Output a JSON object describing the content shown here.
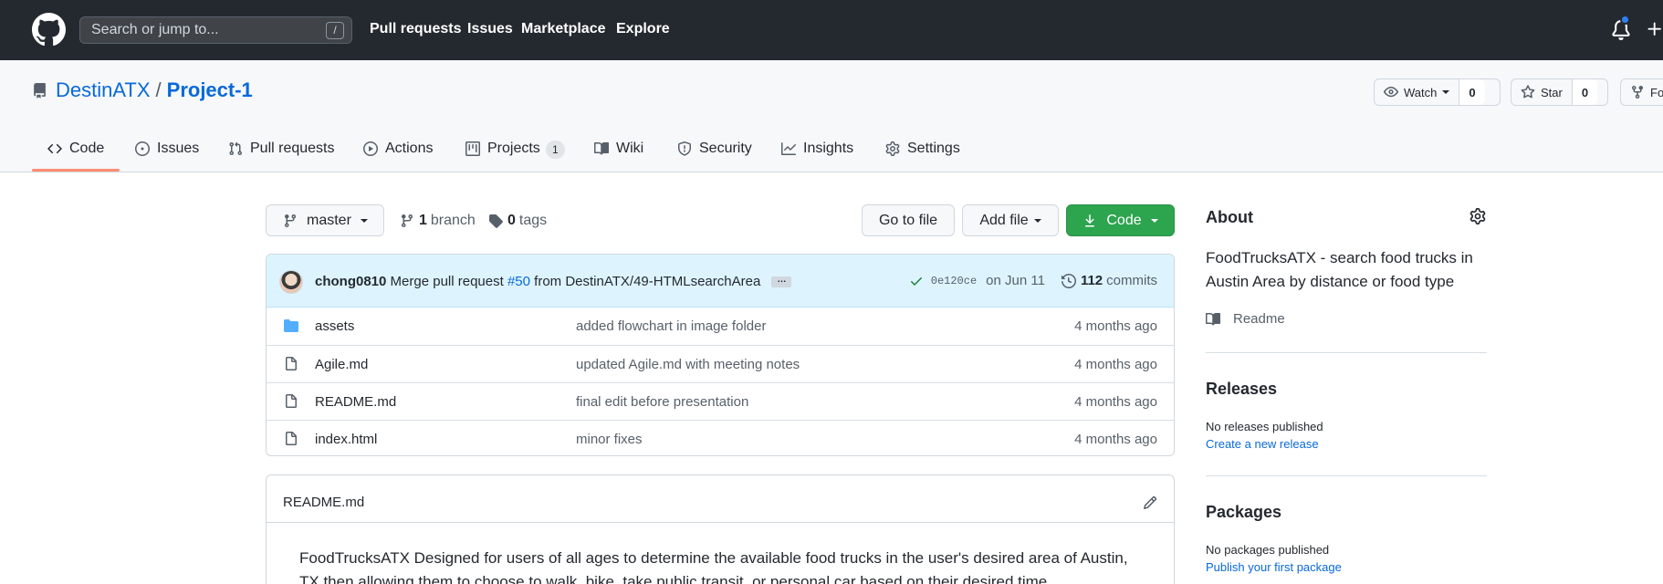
{
  "header": {
    "search_placeholder": "Search or jump to...",
    "search_shortcut": "/",
    "nav": [
      "Pull requests",
      "Issues",
      "Marketplace",
      "Explore"
    ]
  },
  "repo": {
    "owner": "DestinATX",
    "separator": "/",
    "name": "Project-1",
    "watch_label": "Watch",
    "watch_count": "0",
    "star_label": "Star",
    "star_count": "0",
    "fork_label": "Fo"
  },
  "tabs": [
    {
      "label": "Code"
    },
    {
      "label": "Issues"
    },
    {
      "label": "Pull requests"
    },
    {
      "label": "Actions"
    },
    {
      "label": "Projects",
      "count": "1"
    },
    {
      "label": "Wiki"
    },
    {
      "label": "Security"
    },
    {
      "label": "Insights"
    },
    {
      "label": "Settings"
    }
  ],
  "toolbar": {
    "branch": "master",
    "branch_count": "1",
    "branch_label": "branch",
    "tag_count": "0",
    "tag_label": "tags",
    "go_to_file": "Go to file",
    "add_file": "Add file",
    "code": "Code"
  },
  "commit": {
    "author": "chong0810",
    "message_prefix": "Merge pull request",
    "pr": "#50",
    "message_suffix": "from DestinATX/49-HTMLsearchArea",
    "ellipsis": "…",
    "sha": "0e120ce",
    "date": "on Jun 11",
    "count": "112",
    "count_label": "commits"
  },
  "files": [
    {
      "name": "assets",
      "type": "folder",
      "message": "added flowchart in image folder",
      "age": "4 months ago"
    },
    {
      "name": "Agile.md",
      "type": "file",
      "message": "updated Agile.md with meeting notes",
      "age": "4 months ago"
    },
    {
      "name": "README.md",
      "type": "file",
      "message": "final edit before presentation",
      "age": "4 months ago"
    },
    {
      "name": "index.html",
      "type": "file",
      "message": "minor fixes",
      "age": "4 months ago"
    }
  ],
  "readme": {
    "title": "README.md",
    "body": "FoodTrucksATX Designed for users of all ages to determine the available food trucks in the user's desired area of Austin, TX then allowing them to choose to walk, bike, take public transit, or personal car based on their desired time"
  },
  "sidebar": {
    "about_heading": "About",
    "description": "FoodTrucksATX - search food trucks in Austin Area by distance or food type",
    "readme_link": "Readme",
    "releases_heading": "Releases",
    "releases_text": "No releases published",
    "releases_link": "Create a new release",
    "packages_heading": "Packages",
    "packages_text": "No packages published",
    "packages_link": "Publish your first package"
  },
  "colors": {
    "header_bg": "#24292f",
    "link": "#0969da",
    "green_button": "#2da44e",
    "tab_underline": "#fd8c73",
    "commit_bar": "#ddf4ff",
    "folder_icon": "#54aeff"
  }
}
